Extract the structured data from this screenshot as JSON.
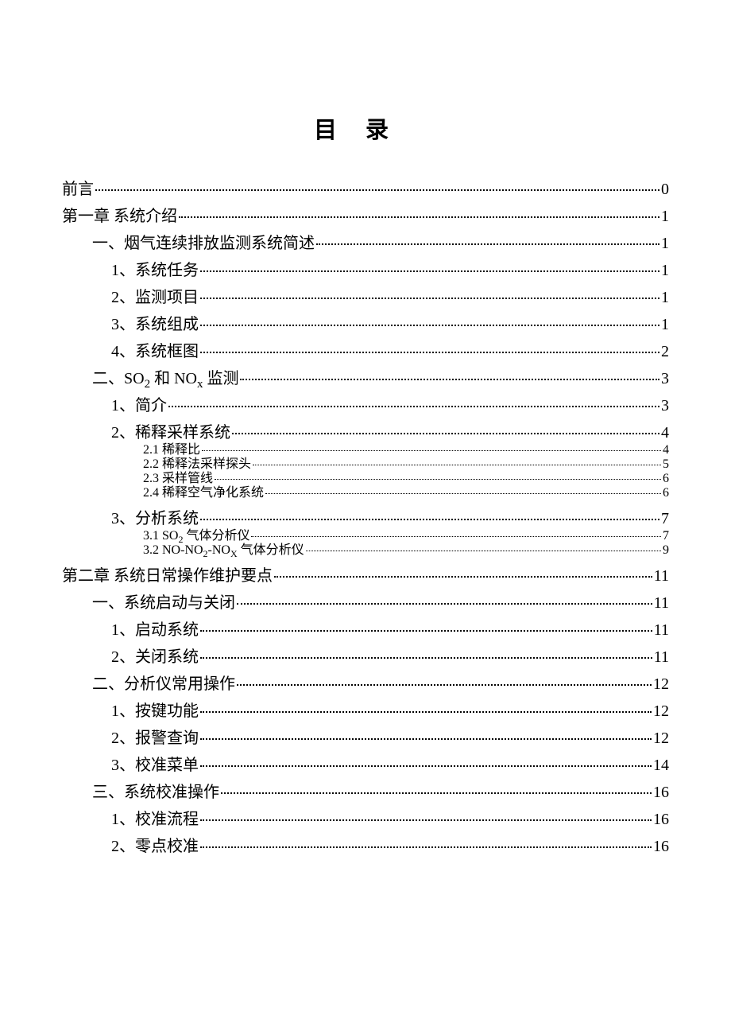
{
  "title": "目录",
  "toc": [
    {
      "level": 0,
      "label": "前言",
      "page": "0"
    },
    {
      "level": 0,
      "label": "第一章  系统介绍",
      "page": "1"
    },
    {
      "level": 1,
      "label": "一、烟气连续排放监测系统简述",
      "page": "1"
    },
    {
      "level": 2,
      "label": "1、系统任务",
      "page": "1"
    },
    {
      "level": 2,
      "label": "2、监测项目",
      "page": "1"
    },
    {
      "level": 2,
      "label": "3、系统组成",
      "page": "1"
    },
    {
      "level": 2,
      "label": "4、系统框图",
      "page": "2"
    },
    {
      "level": 1,
      "label": "二、SO₂ 和 NOₓ 监测",
      "html": "二、SO<sub>2</sub> 和 NO<sub>x</sub> 监测",
      "page": "3"
    },
    {
      "level": 2,
      "label": "1、简介",
      "page": "3"
    },
    {
      "level": 2,
      "label": "2、稀释采样系统",
      "page": "4"
    },
    {
      "level": 3,
      "label": "2.1 稀释比",
      "page": "4"
    },
    {
      "level": 3,
      "label": "2.2 稀释法采样探头",
      "page": "5"
    },
    {
      "level": 3,
      "label": "2.3 采样管线",
      "page": "6"
    },
    {
      "level": 3,
      "label": "2.4 稀释空气净化系统",
      "page": "6"
    },
    {
      "level": 2,
      "label": "3、分析系统",
      "page": "7"
    },
    {
      "level": 3,
      "label": "3.1 SO₂ 气体分析仪",
      "html": "3.1 SO<sub>2</sub> 气体分析仪",
      "page": "7"
    },
    {
      "level": 3,
      "label": "3.2 NO-NO₂-NOₓ 气体分析仪",
      "html": "3.2 NO-NO<sub>2</sub>-NO<sub>X</sub> 气体分析仪",
      "page": "9"
    },
    {
      "level": 0,
      "label": "第二章  系统日常操作维护要点",
      "page": "11"
    },
    {
      "level": 1,
      "label": "一、系统启动与关闭",
      "page": "11"
    },
    {
      "level": 2,
      "label": "1、启动系统",
      "page": "11"
    },
    {
      "level": 2,
      "label": "2、关闭系统",
      "page": "11"
    },
    {
      "level": 1,
      "label": "二、分析仪常用操作",
      "page": "12"
    },
    {
      "level": 2,
      "label": "1、按键功能",
      "page": "12"
    },
    {
      "level": 2,
      "label": "2、报警查询",
      "page": "12"
    },
    {
      "level": 2,
      "label": "3、校准菜单",
      "page": "14"
    },
    {
      "level": 1,
      "label": "三、系统校准操作",
      "page": "16"
    },
    {
      "level": 2,
      "label": "1、校准流程",
      "page": "16"
    },
    {
      "level": 2,
      "label": "2、零点校准",
      "page": "16"
    }
  ]
}
